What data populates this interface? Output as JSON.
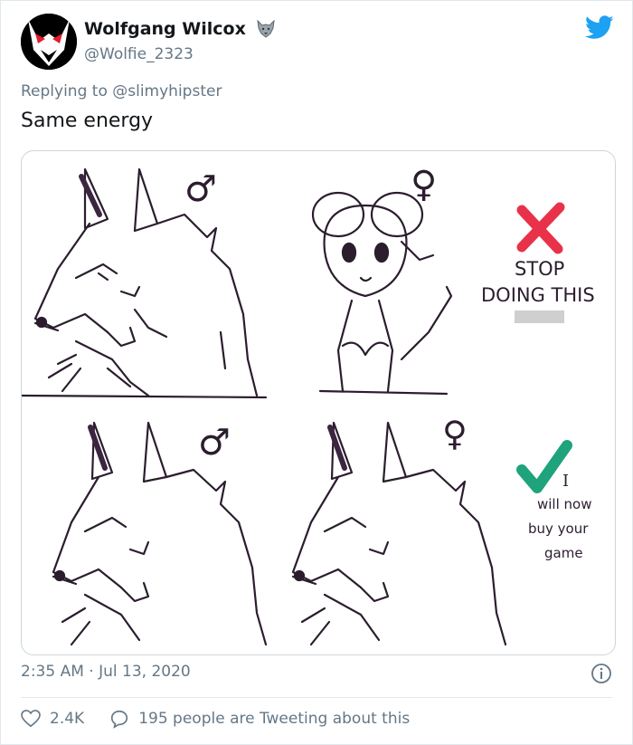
{
  "author": {
    "name": "Wolfgang Wilcox",
    "handle": "@Wolfie_2323"
  },
  "reply": {
    "prefix": "Replying to",
    "to": "@slimyhipster"
  },
  "tweet_text": "Same energy",
  "image": {
    "top_symbol_male": "♂",
    "top_symbol_female": "♀",
    "verdict_bad": [
      "STOP",
      "DOING THIS"
    ],
    "bottom_symbol_male": "♂",
    "bottom_symbol_female": "♀",
    "verdict_good": [
      "I",
      "will now",
      "buy your",
      "game"
    ]
  },
  "timestamp": "2:35 AM · Jul 13, 2020",
  "likes": "2.4K",
  "discussion": "195 people are Tweeting about this",
  "colors": {
    "twitter_blue": "#1da1f2",
    "muted": "#657786",
    "cross_red": "#e8324a",
    "check_green": "#1ea37c"
  },
  "icons": [
    "wolf-badge-icon",
    "twitter-bird-icon",
    "info-icon",
    "heart-icon",
    "speech-bubble-icon",
    "red-x-icon",
    "green-check-icon"
  ]
}
